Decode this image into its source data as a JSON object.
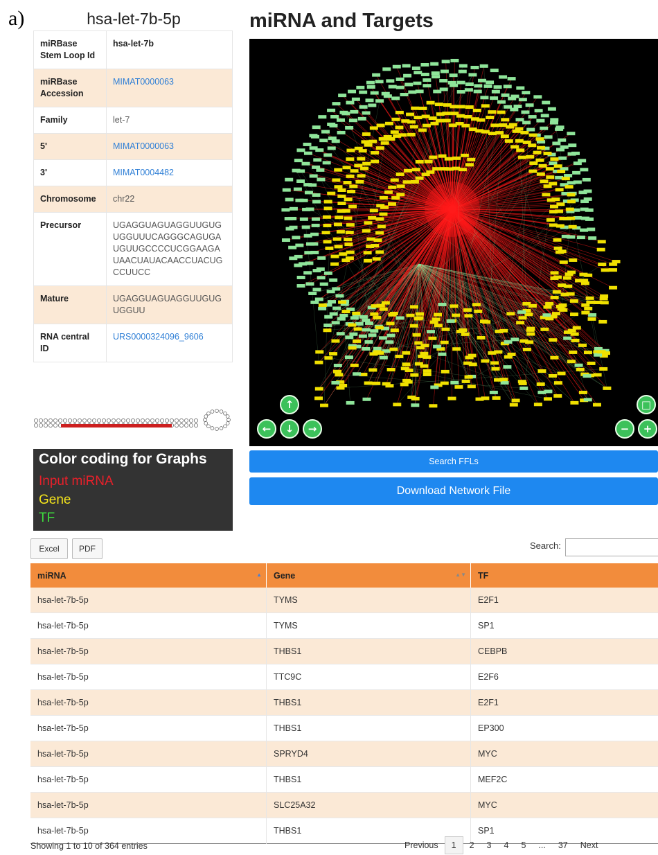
{
  "panel_label": "a)",
  "mirna_name": "hsa-let-7b-5p",
  "info_table": [
    {
      "key": "miRBase Stem Loop Id",
      "value": "hsa-let-7b",
      "style": "bold"
    },
    {
      "key": "miRBase Accession",
      "value": "MIMAT0000063",
      "style": "link"
    },
    {
      "key": "Family",
      "value": "let-7",
      "style": "plain"
    },
    {
      "key": "5'",
      "value": "MIMAT0000063",
      "style": "link"
    },
    {
      "key": "3'",
      "value": "MIMAT0004482",
      "style": "link"
    },
    {
      "key": "Chromosome",
      "value": "chr22",
      "style": "plain"
    },
    {
      "key": "Precursor",
      "value": "UGAGGUAGUAGGUUGUGUGGUUUCAGGGCAGUGAUGUUGCCCCUCGGAAGAUAACUAUACAACCUACUGCCUUCC",
      "style": "plain"
    },
    {
      "key": "Mature",
      "value": "UGAGGUAGUAGGUUGUGUGGUU",
      "style": "plain"
    },
    {
      "key": "RNA central ID",
      "value": "URS0000324096_9606",
      "style": "link"
    }
  ],
  "legend": {
    "title": "Color coding for Graphs",
    "items": [
      {
        "label": "Input miRNA",
        "color": "#e8202a"
      },
      {
        "label": "Gene",
        "color": "#f5e51b"
      },
      {
        "label": "TF",
        "color": "#3ddc3d"
      }
    ]
  },
  "graph": {
    "title": "miRNA and Targets",
    "controls": [
      "arrow-up-icon",
      "arrow-left-icon",
      "arrow-down-icon",
      "arrow-right-icon",
      "fit-icon",
      "zoom-out-icon",
      "zoom-in-icon"
    ],
    "colors": {
      "background": "#000000",
      "mirna": "#ff1a1a",
      "gene": "#f0e000",
      "tf": "#8fe59a"
    }
  },
  "buttons": {
    "search_ffls": "Search FFLs",
    "download": "Download Network File",
    "excel": "Excel",
    "pdf": "PDF"
  },
  "search": {
    "label": "Search:",
    "value": ""
  },
  "table": {
    "headers": [
      "miRNA",
      "Gene",
      "TF"
    ],
    "rows": [
      [
        "hsa-let-7b-5p",
        "TYMS",
        "E2F1"
      ],
      [
        "hsa-let-7b-5p",
        "TYMS",
        "SP1"
      ],
      [
        "hsa-let-7b-5p",
        "THBS1",
        "CEBPB"
      ],
      [
        "hsa-let-7b-5p",
        "TTC9C",
        "E2F6"
      ],
      [
        "hsa-let-7b-5p",
        "THBS1",
        "E2F1"
      ],
      [
        "hsa-let-7b-5p",
        "THBS1",
        "EP300"
      ],
      [
        "hsa-let-7b-5p",
        "SPRYD4",
        "MYC"
      ],
      [
        "hsa-let-7b-5p",
        "THBS1",
        "MEF2C"
      ],
      [
        "hsa-let-7b-5p",
        "SLC25A32",
        "MYC"
      ],
      [
        "hsa-let-7b-5p",
        "THBS1",
        "SP1"
      ]
    ]
  },
  "table_info": "Showing 1 to 10 of 364 entries",
  "pagination": {
    "previous": "Previous",
    "pages": [
      "1",
      "2",
      "3",
      "4",
      "5",
      "...",
      "37"
    ],
    "current": "1",
    "next": "Next"
  }
}
